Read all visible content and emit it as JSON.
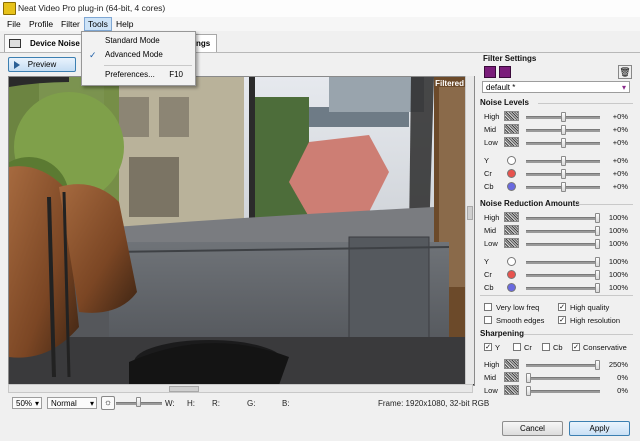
{
  "window": {
    "title": "Neat Video Pro plug-in (64-bit, 4 cores)"
  },
  "menubar": {
    "items": [
      "File",
      "Profile",
      "Filter",
      "Tools",
      "Help"
    ]
  },
  "tools_menu": {
    "standard_mode": "Standard Mode",
    "advanced_mode": "Advanced Mode",
    "preferences": "Preferences...",
    "preferences_shortcut": "F10"
  },
  "tabs": {
    "device_noise": "Device Noise P",
    "settings_partial": "ngs"
  },
  "preview": {
    "button": "Preview",
    "filtered_label": "Filtered"
  },
  "bottom": {
    "zoom": "50%",
    "mode": "Normal",
    "w_label": "W:",
    "h_label": "H:",
    "r_label": "R:",
    "g_label": "G:",
    "b_label": "B:",
    "frame_info": "Frame: 1920x1080, 32-bit RGB",
    "cancel": "Cancel",
    "apply": "Apply"
  },
  "filter_settings": {
    "title": "Filter Settings",
    "preset": "default *"
  },
  "noise_levels": {
    "title": "Noise Levels",
    "rows": [
      {
        "label": "High",
        "value": "+0%",
        "level": 0.5
      },
      {
        "label": "Mid",
        "value": "+0%",
        "level": 0.5
      },
      {
        "label": "Low",
        "value": "+0%",
        "level": 0.5
      },
      {
        "label": "Y",
        "value": "+0%",
        "level": 0.5,
        "color": "#ffffff"
      },
      {
        "label": "Cr",
        "value": "+0%",
        "level": 0.5,
        "color": "#e8534e"
      },
      {
        "label": "Cb",
        "value": "+0%",
        "level": 0.5,
        "color": "#6a6ae0"
      }
    ]
  },
  "noise_reduction": {
    "title": "Noise Reduction Amounts",
    "rows": [
      {
        "label": "High",
        "value": "100%",
        "level": 1.0
      },
      {
        "label": "Mid",
        "value": "100%",
        "level": 1.0
      },
      {
        "label": "Low",
        "value": "100%",
        "level": 1.0
      },
      {
        "label": "Y",
        "value": "100%",
        "level": 1.0,
        "color": "#ffffff"
      },
      {
        "label": "Cr",
        "value": "100%",
        "level": 1.0,
        "color": "#e8534e"
      },
      {
        "label": "Cb",
        "value": "100%",
        "level": 1.0,
        "color": "#6a6ae0"
      }
    ]
  },
  "options": {
    "very_low_freq": "Very low freq",
    "high_quality": "High quality",
    "smooth_edges": "Smooth edges",
    "high_resolution": "High resolution"
  },
  "sharpening": {
    "title": "Sharpening",
    "y": "Y",
    "cr": "Cr",
    "cb": "Cb",
    "conservative": "Conservative",
    "rows": [
      {
        "label": "High",
        "value": "250%",
        "level": 1.0
      },
      {
        "label": "Mid",
        "value": "0%",
        "level": 0.0
      },
      {
        "label": "Low",
        "value": "0%",
        "level": 0.0
      }
    ]
  }
}
